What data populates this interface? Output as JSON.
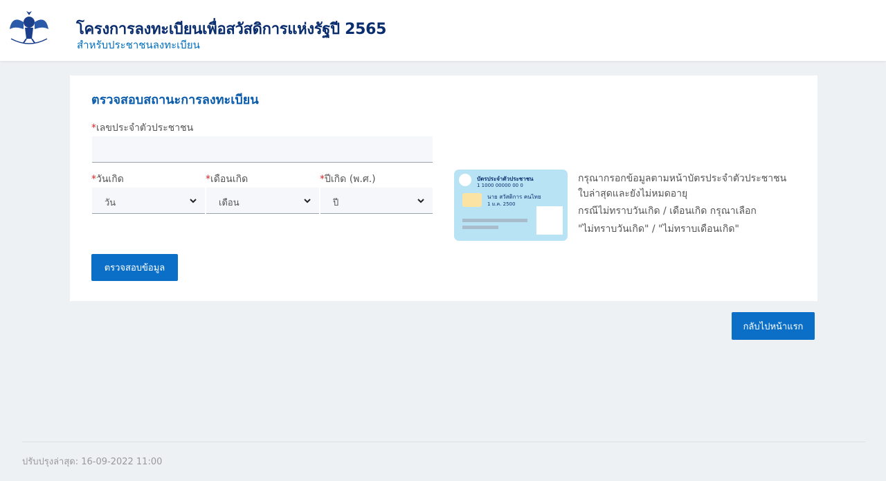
{
  "header": {
    "title": "โครงการลงทะเบียนเพื่อสวัสดิการแห่งรัฐปี 2565",
    "subtitle": "สำหรับประชาชนลงทะเบียน"
  },
  "form": {
    "title": "ตรวจสอบสถานะการลงทะเบียน",
    "required_mark": "*",
    "id_label": "เลขประจำตัวประชาชน",
    "id_value": "",
    "day_label": "วันเกิด",
    "day_selected": "วัน",
    "month_label": "เดือนเกิด",
    "month_selected": "เดือน",
    "year_label": "ปีเกิด (พ.ศ.)",
    "year_selected": "ปี",
    "submit_label": "ตรวจสอบข้อมูล"
  },
  "idcard": {
    "title": "บัตรประจำตัวประชาชน",
    "number": "1 1000 00000 00 0",
    "name": "นาย สวัสดิการ คนไทย",
    "dob": "1 ม.ค. 2500"
  },
  "help": {
    "line1": "กรุณากรอกข้อมูลตามหน้าบัตรประจำตัวประชาชน",
    "line2": "ใบล่าสุดและยังไม่หมดอายุ",
    "line3": "กรณีไม่ทราบวันเกิด / เดือนเกิด กรุณาเลือก",
    "line4": "\"ไม่ทราบวันเกิด\" / \"ไม่ทราบเดือนเกิด\""
  },
  "back_label": "กลับไปหน้าแรก",
  "footer": {
    "updated": "ปรับปรุงล่าสุด: 16-09-2022 11:00"
  },
  "colors": {
    "primary": "#0b6fc7",
    "title": "#0a2d6e",
    "accent": "#0b5cab",
    "required": "#e02424"
  },
  "icons": {
    "logo": "garuda-emblem-icon",
    "dropdown": "chevron-down-icon"
  }
}
